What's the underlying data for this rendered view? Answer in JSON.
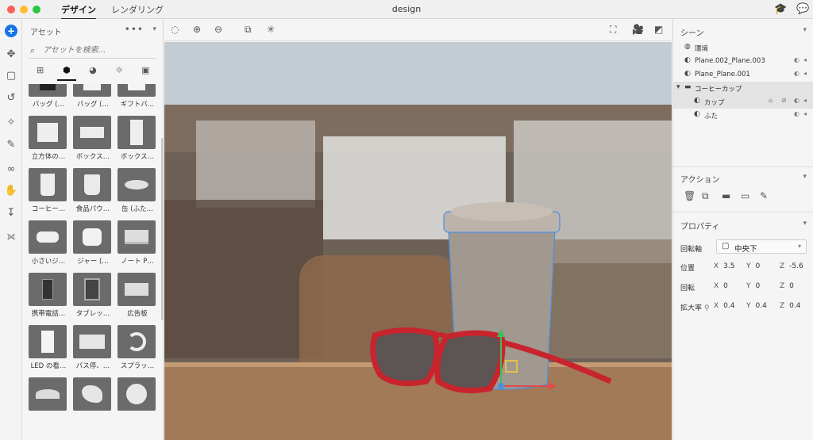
{
  "titlebar": {
    "tabs": [
      {
        "label": "デザイン",
        "active": true
      },
      {
        "label": "レンダリング",
        "active": false
      }
    ],
    "document_title": "design",
    "right_icons": [
      "learn-icon",
      "feedback-icon"
    ]
  },
  "colors": {
    "accent": "#1473e6",
    "close": "#ff5f57",
    "minimize": "#febc2e",
    "zoom": "#28c840",
    "selection_outline": "#4a90e2",
    "glasses_red": "#c8242e"
  },
  "tools": [
    "add-icon",
    "select-icon",
    "frame-icon",
    "undo-rotate-icon",
    "magic-wand-icon",
    "eyedropper-icon",
    "link-icon",
    "hand-icon",
    "arrow-down-icon",
    "measure-icon"
  ],
  "assets": {
    "title": "アセット",
    "more": "•••",
    "search_placeholder": "アセットを検索...",
    "categories": [
      "library-icon",
      "model-icon",
      "material-icon",
      "light-icon",
      "image-icon"
    ],
    "items": [
      {
        "label": "バッグ (…",
        "kind": "bag-dark"
      },
      {
        "label": "バッグ (…",
        "kind": "bag-white"
      },
      {
        "label": "ギフトバ…",
        "kind": "bag-gift"
      },
      {
        "label": "立方体の…",
        "kind": "cube"
      },
      {
        "label": "ボックス…",
        "kind": "box-flat"
      },
      {
        "label": "ボックス…",
        "kind": "box-tall"
      },
      {
        "label": "コーヒー…",
        "kind": "cup"
      },
      {
        "label": "食品パウ…",
        "kind": "pouch"
      },
      {
        "label": "缶 (ふた…",
        "kind": "tin"
      },
      {
        "label": "小さいジ…",
        "kind": "jar-small"
      },
      {
        "label": "ジャー (…",
        "kind": "jar"
      },
      {
        "label": "ノート P…",
        "kind": "laptop"
      },
      {
        "label": "携帯電話…",
        "kind": "phone"
      },
      {
        "label": "タブレッ…",
        "kind": "tablet"
      },
      {
        "label": "広告板",
        "kind": "billboard"
      },
      {
        "label": "LED の看…",
        "kind": "led-sign"
      },
      {
        "label": "バス停、…",
        "kind": "bus-stop"
      },
      {
        "label": "スプラッ…",
        "kind": "splash"
      },
      {
        "label": "",
        "kind": "wave"
      },
      {
        "label": "",
        "kind": "splash2"
      },
      {
        "label": "",
        "kind": "sphere"
      }
    ]
  },
  "viewport": {
    "left_tools": [
      "select-circle-icon",
      "add-selection-icon",
      "subtract-selection-icon",
      "place-image-icon",
      "network-icon"
    ],
    "right_tools": [
      "fit-icon",
      "camera-icon",
      "histogram-icon"
    ]
  },
  "scene": {
    "title": "シーン",
    "items": [
      {
        "label": "環境",
        "icon": "globe-icon",
        "depth": 0,
        "selected": false,
        "folder": false,
        "lock": false
      },
      {
        "label": "Plane.002_Plane.003",
        "icon": "model-icon",
        "depth": 0,
        "selected": false,
        "folder": false,
        "lock": false
      },
      {
        "label": "Plane_Plane.001",
        "icon": "model-icon",
        "depth": 0,
        "selected": false,
        "folder": false,
        "lock": false
      },
      {
        "label": "コーヒーカップ",
        "icon": "folder-icon",
        "depth": 0,
        "selected": true,
        "folder": true,
        "lock": false
      },
      {
        "label": "カップ",
        "icon": "model-icon",
        "depth": 1,
        "selected": true,
        "folder": false,
        "lock": true
      },
      {
        "label": "ふた",
        "icon": "model-icon",
        "depth": 1,
        "selected": false,
        "folder": false,
        "lock": false
      }
    ]
  },
  "actions": {
    "title": "アクション",
    "icons": [
      "delete-icon",
      "duplicate-icon",
      "group-icon",
      "ungroup-icon",
      "eyedropper-icon"
    ]
  },
  "properties": {
    "title": "プロパティ",
    "pivot_label": "回転軸",
    "pivot_value": "中央下",
    "position": {
      "label": "位置",
      "x": "3.5",
      "y": "0",
      "z": "-5.6"
    },
    "rotation": {
      "label": "回転",
      "x": "0",
      "y": "0",
      "z": "0"
    },
    "scale": {
      "label": "拡大率",
      "x": "0.4",
      "y": "0.4",
      "z": "0.4"
    },
    "axis_x": "X",
    "axis_y": "Y",
    "axis_z": "Z"
  }
}
